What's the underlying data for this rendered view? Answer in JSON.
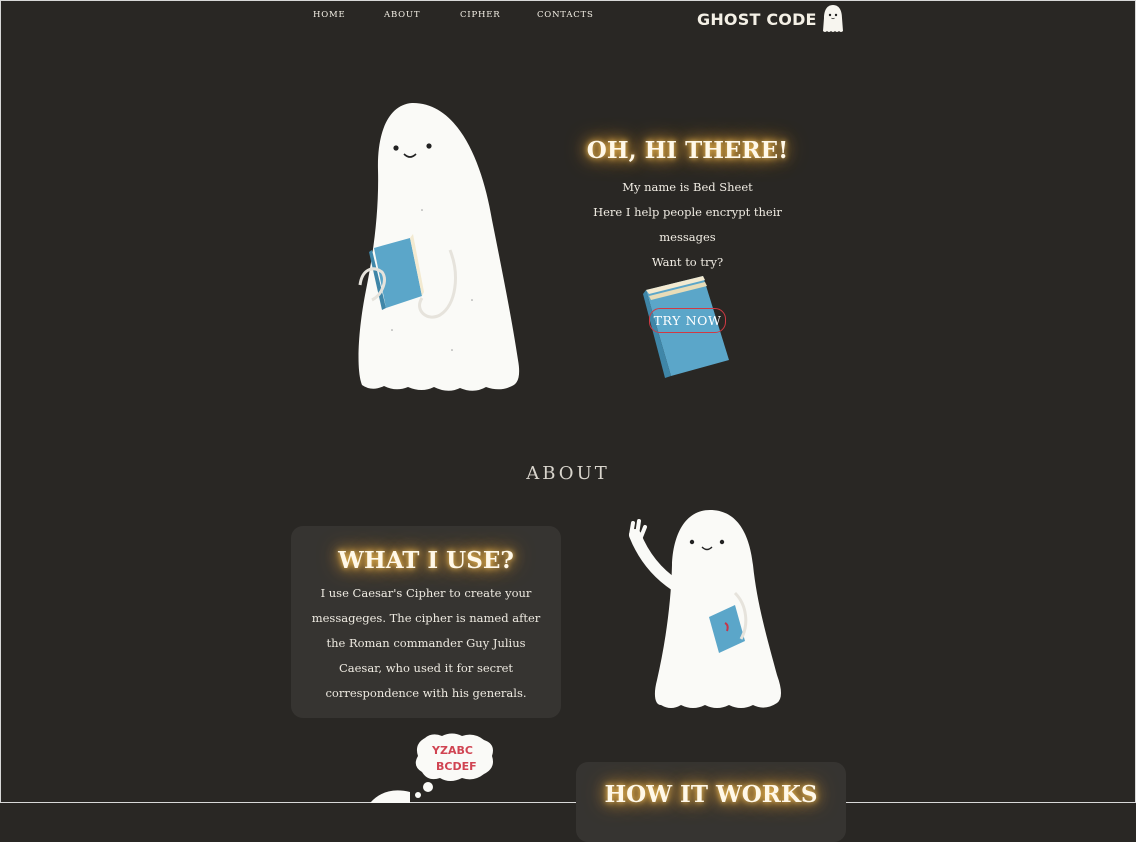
{
  "nav": {
    "items": [
      "HOME",
      "ABOUT",
      "CIPHER",
      "CONTACTS"
    ],
    "logo_text": "GHOST CODE",
    "logo_icon": "ghost-icon"
  },
  "hero": {
    "title": "OH, HI THERE!",
    "lines": [
      "My name is Bed Sheet",
      "Here I help people encrypt their",
      "messages",
      "Want to try?"
    ],
    "button_label": "TRY NOW"
  },
  "about": {
    "heading": "ABOUT",
    "what_title": "WHAT I USE?",
    "what_body": "I use Caesar's Cipher to create your messageges. The cipher is named after the Roman commander Guy Julius Caesar, who used it for secret correspondence with his generals.",
    "thought_letters": [
      "YZABC",
      "BCDEF"
    ],
    "how_title": "HOW IT WORKS"
  },
  "colors": {
    "background": "#292724",
    "card": "#363431",
    "glow": "#f6c35a",
    "button_border": "#d03a44",
    "book_blue": "#5ba6c9"
  }
}
